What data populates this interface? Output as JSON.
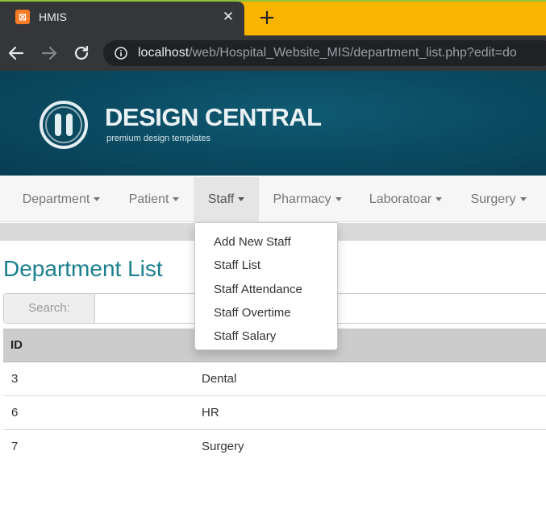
{
  "browser": {
    "tab_title": "HMIS",
    "favicon_label": "⊠",
    "close_icon": "close-icon",
    "new_tab_icon": "plus-icon",
    "url_host": "localhost",
    "url_path": "/web/Hospital_Website_MIS/department_list.php?edit=do"
  },
  "banner": {
    "brand_title": "DESIGN CENTRAL",
    "brand_subtitle": "premium design templates"
  },
  "navbar": {
    "items": [
      {
        "label": "Department"
      },
      {
        "label": "Patient"
      },
      {
        "label": "Staff"
      },
      {
        "label": "Pharmacy"
      },
      {
        "label": "Laboratoar"
      },
      {
        "label": "Surgery"
      }
    ],
    "active": "Staff"
  },
  "staff_menu": {
    "items": [
      "Add New Staff",
      "Staff List",
      "Staff Attendance",
      "Staff Overtime",
      "Staff Salary"
    ]
  },
  "page": {
    "title": "Department List",
    "search_label": "Search:",
    "search_value": ""
  },
  "table": {
    "headers": [
      "ID",
      ""
    ],
    "rows": [
      {
        "id": "3",
        "name": "Dental"
      },
      {
        "id": "6",
        "name": "HR"
      },
      {
        "id": "7",
        "name": "Surgery"
      }
    ]
  },
  "colors": {
    "tab_strip": "#f9b400",
    "chrome_dark": "#35363a",
    "banner": "#0b4c63",
    "title_accent": "#1a7f8e"
  }
}
